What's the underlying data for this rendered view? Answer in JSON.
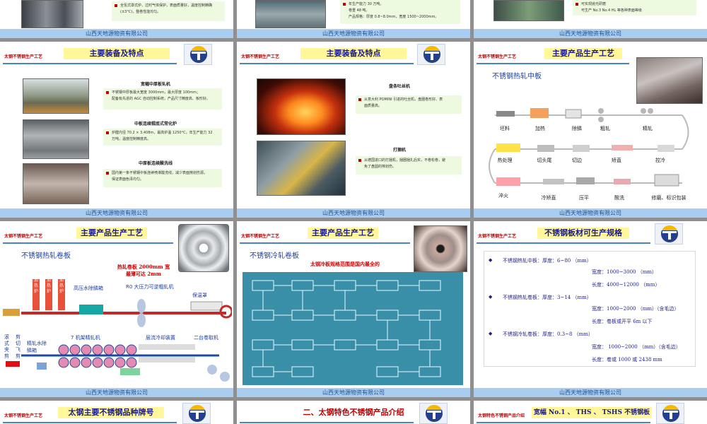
{
  "company": "山西天地源物资有限公司",
  "slide_tag": "太钢不锈钢生产工艺",
  "colors": {
    "footer": "#a9cdf0",
    "header_bg": "#fff799",
    "accent_red": "#c00000",
    "title_blue": "#1d3e9c"
  },
  "row1": {
    "s1_notes": [
      "全氢式罩式炉，过时气体保护，表面质量好，温度控制精确",
      "(±3°C)，整卷性能均匀。"
    ],
    "s2_notes": [
      "年生产能力 30 万吨。",
      "卷重 48 吨。",
      "产品规格：厚度 0.8~8.0mm，宽度 1500~2000mm。"
    ],
    "s3_notes": [
      "可实现抛光研磨",
      "可生产 No.3 No.4 HL 等各种表面等级"
    ]
  },
  "s4": {
    "title": "主要装备及特点",
    "sections": [
      {
        "caption": "宽幅中厚板轧机",
        "notes": [
          "不锈钢中厚板最大宽度 3000mm，最大厚度 100mm；",
          "配备有先进的 AGC 自动控制系统，产品尺寸精度高、板形好。"
        ]
      },
      {
        "caption": "中板连续辊底式常化炉",
        "notes": [
          "炉膛内径 70.2 × 3.408m，最高炉温 1250°C，年生产能力 32",
          "万吨，温度控制精度高。"
        ]
      },
      {
        "caption": "中厚板连续酸洗线",
        "notes": [
          "国内第一条不锈钢中板连续喷淋酸洗线，减少表面擦划伤源，",
          "保证表面色泽均匀。"
        ]
      }
    ]
  },
  "s5": {
    "title": "主要装备及特点",
    "sections": [
      {
        "caption": "盘条吐丝机",
        "notes": [
          "从意大利 POMINI 引进的吐丝机，盘圈卷形好、表",
          "面质量高。"
        ]
      },
      {
        "caption": "打捆机",
        "notes": [
          "从德国进口的打捆机，捆圈捆扎后实，不卷松卷，避",
          "免了盘圆的擦划伤。"
        ]
      }
    ]
  },
  "s6": {
    "title": "主要产品生产工艺",
    "subtitle": "不锈钢热轧中板",
    "process": [
      "坯料",
      "加热",
      "除鳞",
      "粗轧",
      "精轧",
      "热处理",
      "切头尾",
      "切边",
      "矫直",
      "控冷",
      "淬火",
      "冷矫直",
      "压平",
      "酸洗",
      "修磨、标识包装"
    ]
  },
  "s7": {
    "title": "主要产品生产工艺",
    "subtitle": "不锈钢热轧卷板",
    "red_note": [
      "热轧卷板 2000mm 宽",
      "最薄可达 2mm"
    ],
    "labels": [
      "3#加热炉",
      "2#加热炉",
      "1#加热炉",
      "高压水除鳞箱",
      "R0 大压力可逆粗轧机",
      "保温罩",
      "滚式夹剪",
      "剪切飞剪",
      "精轧水除鳞箱",
      "7 机架精轧机",
      "层流冷却装置",
      "二台卷取机"
    ]
  },
  "s8": {
    "title": "主要产品生产工艺",
    "subtitle": "不锈钢冷轧卷板",
    "red_note": "太钢冷板规格范围是国内最全的"
  },
  "s9": {
    "title": "不锈钢板材可生产规格",
    "specs": [
      {
        "name": "不锈钢热轧中板：厚度：6~80 （mm）",
        "width": "宽度：1000~3000 （mm）",
        "length": "长度：4000~12000 （mm）"
      },
      {
        "name": "不锈钢热轧卷板：厚度：3~14 （mm）",
        "width": "宽度：1000~2000 （mm）（含毛边）",
        "length": "长度：卷板或开平 6m 以下"
      },
      {
        "name": "不锈钢冷轧卷板：厚度：0.3~8 （mm）",
        "width": "宽度： 1000~2000 （mm）（含毛边）",
        "length": "长度：卷或 1000 或 2438 mm"
      }
    ]
  },
  "row4": {
    "s10_title": "太钢主要不锈钢品种牌号",
    "s11_title": "二、太钢特色不锈钢产品介绍",
    "s12_title": "宽幅 No.1 、 THS 、 TSHS 不锈钢板",
    "s12_tag": "太钢特色不锈钢产品介绍"
  }
}
